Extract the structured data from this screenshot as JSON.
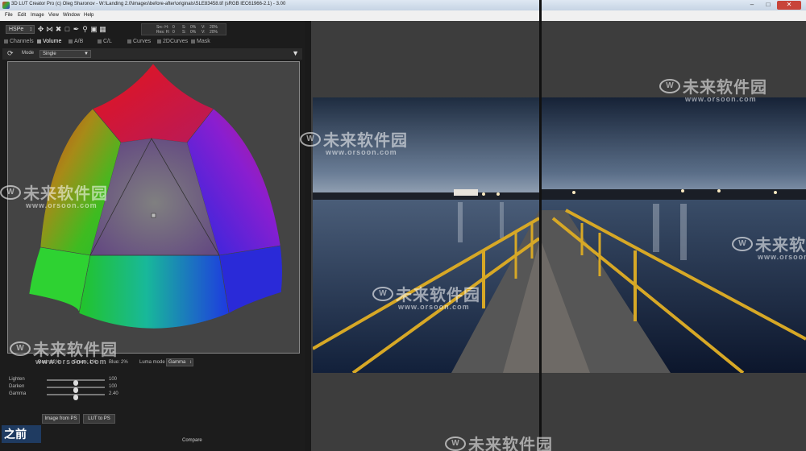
{
  "window": {
    "title": "3D LUT Creator Pro (c) Oleg Sharonov - W:\\Landing 2.0\\images\\before-after\\originals\\SLE83458.tif (sRGB IEC61966-2.1) - 3.00"
  },
  "menu": [
    "File",
    "Edit",
    "Image",
    "View",
    "Window",
    "Help"
  ],
  "toolbar": {
    "color_model": "HSPe",
    "readout": {
      "src_label": "Src: H:",
      "src_h": "0",
      "src_s_label": "S:",
      "src_s": "0%",
      "src_v_label": "V:",
      "src_v": "20%",
      "res_label": "Res: H:",
      "res_h": "0",
      "res_s_label": "S:",
      "res_s": "0%",
      "res_v_label": "V:",
      "res_v": "20%"
    }
  },
  "tabs": [
    {
      "label": "Channels"
    },
    {
      "label": "Volume"
    },
    {
      "label": "A/B"
    },
    {
      "label": "C/L"
    },
    {
      "label": "Curves"
    },
    {
      "label": "2DCurves"
    },
    {
      "label": "Mask"
    }
  ],
  "mode_row": {
    "label": "Mode",
    "value": "Single"
  },
  "stats": {
    "red_label": "Red:",
    "red": "92%",
    "green_label": "Green:",
    "green": "1%",
    "blue_label": "Blue:",
    "blue": "2%",
    "luma_label": "Luma mode",
    "luma_value": "Gamma"
  },
  "sliders": [
    {
      "label": "Lighten",
      "value": "100",
      "level": 0.5
    },
    {
      "label": "Darken",
      "value": "100",
      "level": 0.5
    },
    {
      "label": "Gamma",
      "value": "2.40",
      "level": 0.5
    }
  ],
  "buttons": {
    "image_from_ps": "Image from PS",
    "lut_to_ps": "LUT to PS",
    "compare": "Compare"
  },
  "overlay": {
    "before_label": "之前"
  },
  "watermark": {
    "text": "未来软件园",
    "url": "www.orsoon.com"
  },
  "colors": {
    "accent": "#1f3b61",
    "panel": "#1c1c1c",
    "viewer": "#3d3d3d"
  }
}
